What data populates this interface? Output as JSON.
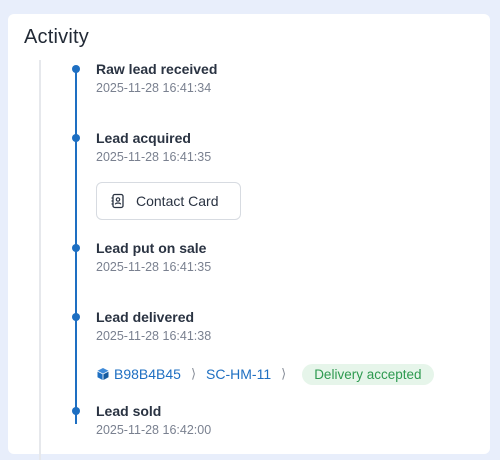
{
  "panel": {
    "title": "Activity"
  },
  "events": [
    {
      "title": "Raw lead received",
      "time": "2025-11-28 16:41:34"
    },
    {
      "title": "Lead acquired",
      "time": "2025-11-28 16:41:35"
    },
    {
      "title": "Lead put on sale",
      "time": "2025-11-28 16:41:35"
    },
    {
      "title": "Lead delivered",
      "time": "2025-11-28 16:41:38"
    },
    {
      "title": "Lead sold",
      "time": "2025-11-28 16:42:00"
    }
  ],
  "contact_card": {
    "label": "Contact Card",
    "icon": "contact-book-icon"
  },
  "delivery": {
    "lead_id": "B98B4B45",
    "lead_icon": "cube-icon",
    "campaign": "SC-HM-11",
    "status": "Delivery accepted"
  },
  "colors": {
    "accent": "#1e6fc2",
    "success_bg": "#e6f5ea",
    "success_text": "#2e9a50"
  }
}
